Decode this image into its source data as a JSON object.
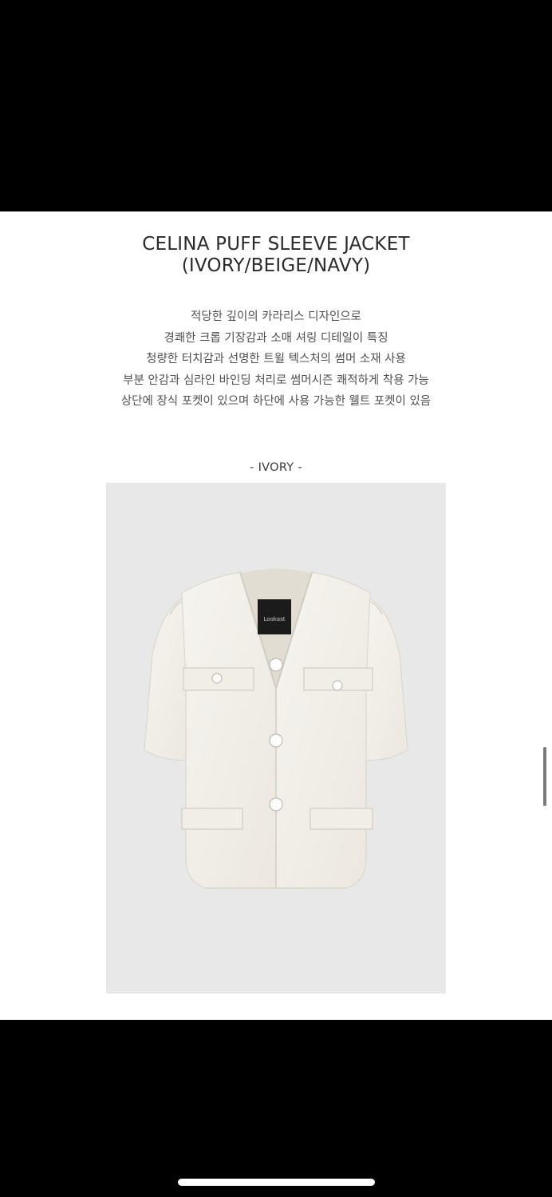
{
  "product": {
    "title_line1": "CELINA PUFF SLEEVE JACKET",
    "title_line2": "(IVORY/BEIGE/NAVY)",
    "description": [
      "적당한 깊이의 카라리스 디자인으로",
      "경쾌한 크롭 기장감과 소매 셔링 디테일이 특징",
      "청량한 터치감과 선명한 트윌 텍스처의 썸머 소재 사용",
      "부분 안감과 심라인 바인딩 처리로 썸머시즌 쾌적하게 착용 가능",
      "상단에 장식 포켓이 있으며 하단에 사용 가능한 웰트 포켓이 있음"
    ],
    "color_section_label": "- IVORY -",
    "label_brand": "Lookast"
  },
  "colors": {
    "page_bg": "#ffffff",
    "photo_bg": "#e8e8e8",
    "jacket_ivory": "#f3f0ea",
    "frame_black": "#000000"
  }
}
